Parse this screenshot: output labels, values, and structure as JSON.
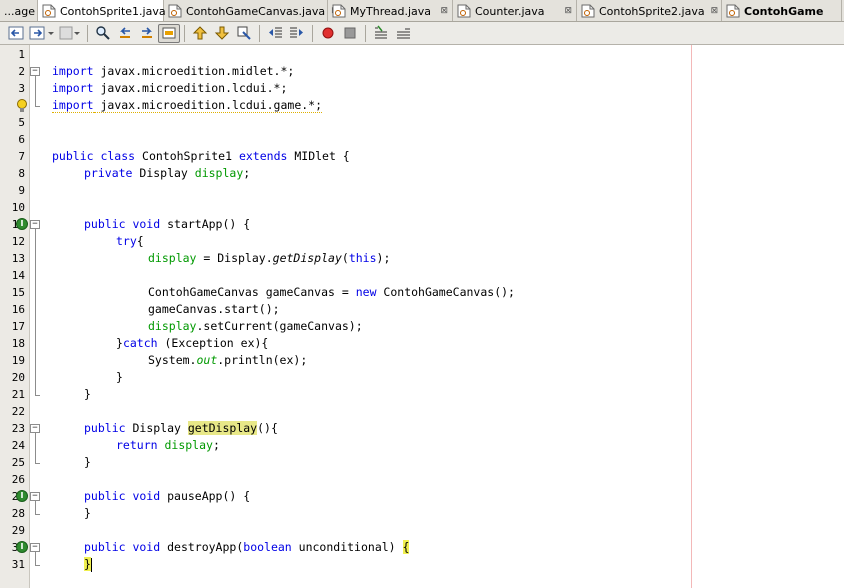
{
  "tabs": [
    {
      "label": "...age",
      "active": false,
      "bold": false,
      "icon": ""
    },
    {
      "label": "ContohSprite1.java",
      "active": true,
      "bold": false,
      "icon": "java-file-icon"
    },
    {
      "label": "ContohGameCanvas.java",
      "active": false,
      "bold": false,
      "icon": "java-file-icon"
    },
    {
      "label": "MyThread.java",
      "active": false,
      "bold": false,
      "icon": "java-file-icon"
    },
    {
      "label": "Counter.java",
      "active": false,
      "bold": false,
      "icon": "java-file-icon"
    },
    {
      "label": "ContohSprite2.java",
      "active": false,
      "bold": false,
      "icon": "java-file-icon"
    },
    {
      "label": "ContohGame",
      "active": false,
      "bold": true,
      "icon": "java-file-icon"
    }
  ],
  "close_glyph": "⊠",
  "toolbar_icons": [
    "back-icon",
    "forward-icon",
    "last-edit-icon",
    "find-icon",
    "find-previous-icon",
    "find-next-icon",
    "toggle-highlight-icon",
    "previous-bookmark-icon",
    "next-bookmark-icon",
    "toggle-bookmark-icon",
    "shift-left-icon",
    "shift-right-icon",
    "start-macro-icon",
    "stop-macro-icon",
    "comment-icon",
    "uncomment-icon"
  ],
  "line_numbers": [
    "1",
    "2",
    "3",
    "4",
    "5",
    "6",
    "7",
    "8",
    "9",
    "10",
    "11",
    "12",
    "13",
    "14",
    "15",
    "16",
    "17",
    "18",
    "19",
    "20",
    "21",
    "22",
    "23",
    "24",
    "25",
    "26",
    "27",
    "28",
    "29",
    "30",
    "31"
  ],
  "code": {
    "l2": [
      "import",
      " javax.microedition.midlet.*;"
    ],
    "l3": [
      "import",
      " javax.microedition.lcdui.*;"
    ],
    "l4": [
      "import",
      " javax.microedition.lcdui.game.*;"
    ],
    "l7": [
      "public class",
      " ContohSprite1 ",
      "extends",
      " MIDlet {"
    ],
    "l8": [
      "private",
      " Display ",
      "display",
      ";"
    ],
    "l11": [
      "public void",
      " startApp() {"
    ],
    "l12": [
      "try",
      "{"
    ],
    "l13": [
      "display",
      " = Display.",
      "getDisplay",
      "(",
      "this",
      ");"
    ],
    "l15": [
      "ContohGameCanvas gameCanvas = ",
      "new",
      " ContohGameCanvas();"
    ],
    "l16": [
      "gameCanvas.start();"
    ],
    "l17": [
      "display",
      ".setCurrent(gameCanvas);"
    ],
    "l18": [
      "}",
      "catch",
      " (Exception ex){"
    ],
    "l19": [
      "System.",
      "out",
      ".println(ex);"
    ],
    "l20": [
      "}"
    ],
    "l21": [
      "}"
    ],
    "l23": [
      "public",
      " Display ",
      "getDisplay",
      "(){"
    ],
    "l24": [
      "return",
      " ",
      "display",
      ";"
    ],
    "l25": [
      "}"
    ],
    "l27": [
      "public void",
      " pauseApp() {"
    ],
    "l28": [
      "}"
    ],
    "l30": [
      "public void",
      " destroyApp(",
      "boolean",
      " unconditional) ",
      "{"
    ],
    "l31": [
      "}"
    ]
  },
  "gutter_marks": {
    "override": "I",
    "fold_open": "−"
  }
}
